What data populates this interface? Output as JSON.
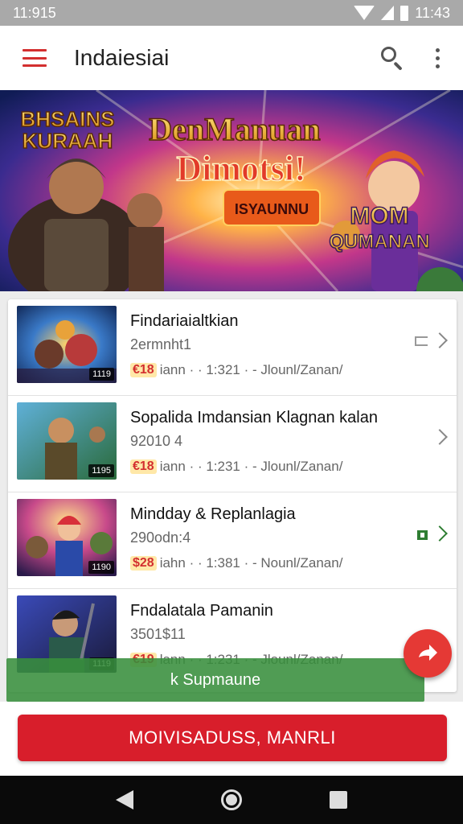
{
  "status_bar": {
    "time_left": "11:915",
    "time_right": "11:43"
  },
  "app_bar": {
    "title": "Indaiesiai"
  },
  "banner": {
    "logo_left_line1": "BHSAINS",
    "logo_left_line2": "KURAAH",
    "headline_line1": "DenManuan",
    "headline_line2": "Dimotsi!",
    "tag": "ISYAUNNU",
    "logo_right_line1": "MOM",
    "logo_right_line2": "QUMANAN"
  },
  "list": {
    "items": [
      {
        "title": "Findariaialtkian",
        "subtitle": "2ermnht1",
        "price": "€18",
        "meta": "iann · · 1:321 · - Jlounl/Zanan/",
        "thumb_tag": "1119",
        "icon": "share-icon"
      },
      {
        "title": "Sopalida Imdansian Klagnan kalan",
        "subtitle": "92010 4",
        "price": "€18",
        "meta": "iann · · 1:231 · - Jlounl/Zanan/",
        "thumb_tag": "1195",
        "icon": "none"
      },
      {
        "title": "Mindday & Replanlagia",
        "subtitle": "290odn:4",
        "price": "$28",
        "meta": "iahn · · 1:381 · - Nounl/Zanan/",
        "thumb_tag": "1190",
        "icon": "green-mark-icon"
      },
      {
        "title": "Fndalatala Pamanin",
        "subtitle": "3501$11",
        "price": "€19",
        "meta": "lann · · 1:231 · - Jlounl/Zanan/",
        "thumb_tag": "1119",
        "icon": "none"
      }
    ]
  },
  "snackbar": {
    "text": "k Supmaune"
  },
  "main_button": {
    "label": "MOIVISADUSS, MANRLI"
  },
  "colors": {
    "accent": "#d81e2b",
    "snackbar": "#388e3c",
    "status_bar": "#a9a9a9"
  },
  "icons": [
    "menu-icon",
    "search-icon",
    "more-vert-icon",
    "chevron-right-icon",
    "share-icon",
    "fab-arrow-icon",
    "nav-back-icon",
    "nav-home-icon",
    "nav-recents-icon"
  ]
}
